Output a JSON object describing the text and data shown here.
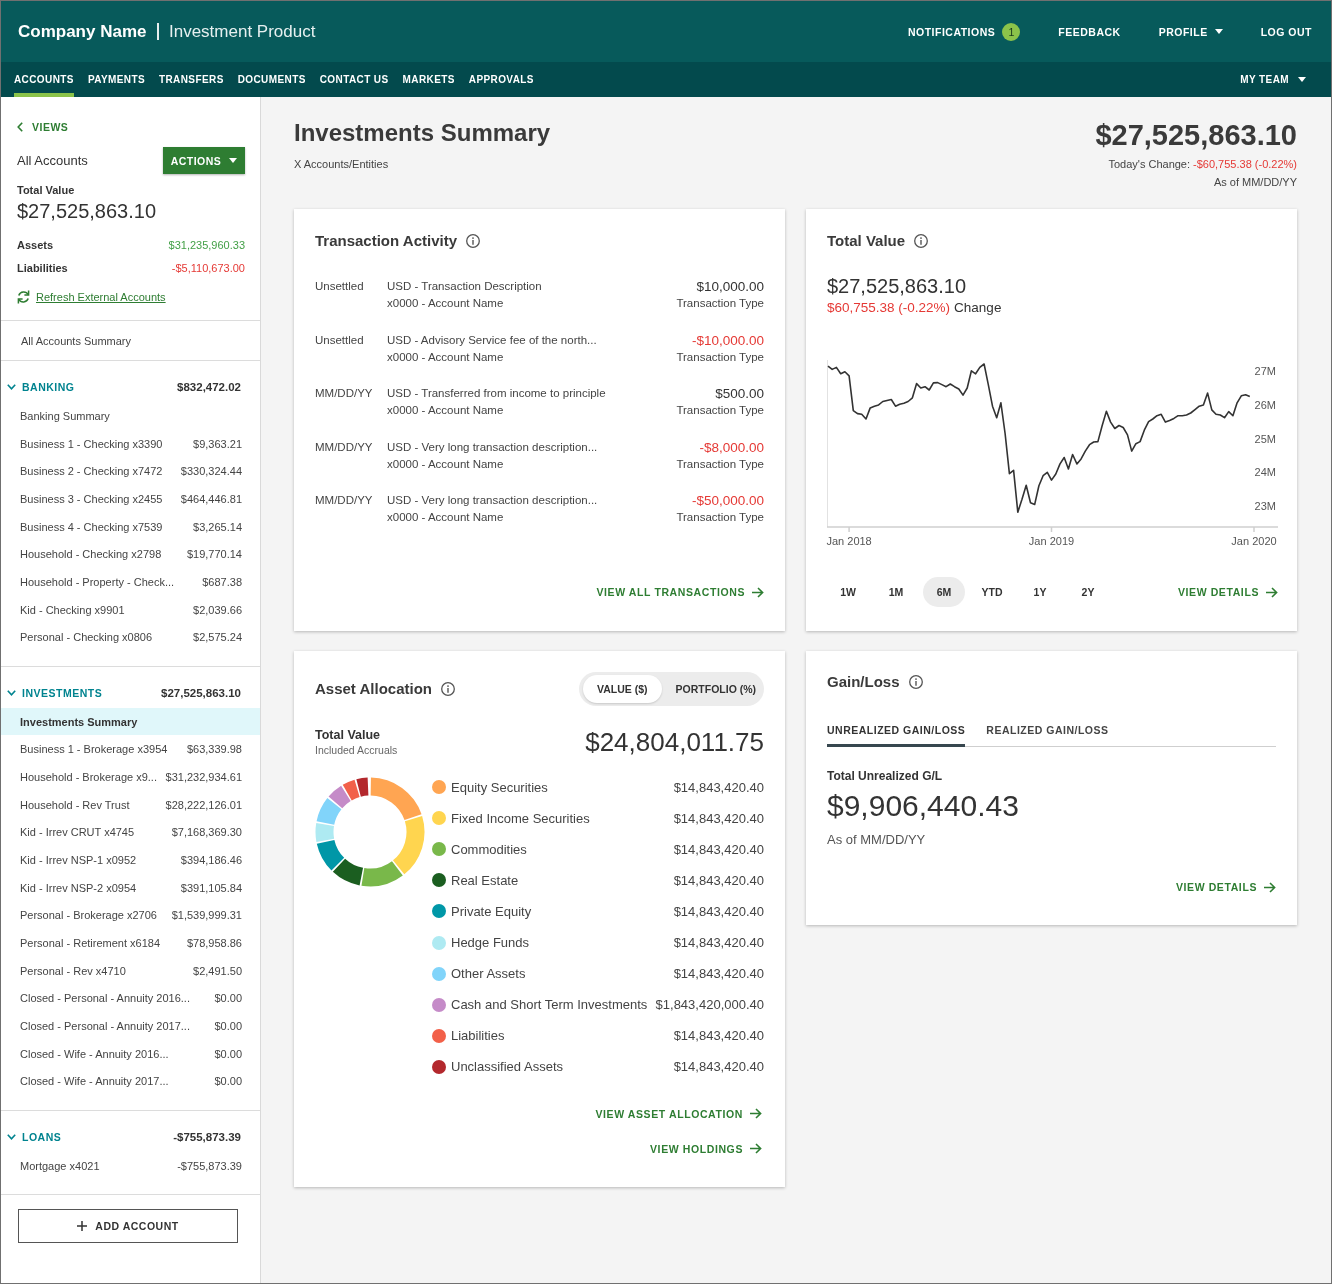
{
  "header": {
    "company": "Company Name",
    "product": "Investment Product",
    "links": [
      {
        "label": "NOTIFICATIONS",
        "badge": "1",
        "dropdown": false
      },
      {
        "label": "FEEDBACK",
        "dropdown": false
      },
      {
        "label": "PROFILE",
        "dropdown": true
      },
      {
        "label": "LOG OUT",
        "dropdown": false
      }
    ]
  },
  "nav": {
    "tabs": [
      {
        "label": "ACCOUNTS",
        "selected": true
      },
      {
        "label": "PAYMENTS",
        "selected": false
      },
      {
        "label": "TRANSFERS",
        "selected": false
      },
      {
        "label": "DOCUMENTS",
        "selected": false
      },
      {
        "label": "CONTACT US",
        "selected": false
      },
      {
        "label": "MARKETS",
        "selected": false
      },
      {
        "label": "APPROVALS",
        "selected": false
      }
    ],
    "team": {
      "label": "MY TEAM",
      "dropdown": true
    }
  },
  "sidebar": {
    "back_link": "VIEWS",
    "title": "All Accounts",
    "actions_button": "ACTIONS",
    "total_label": "Total Value",
    "total_value": "$27,525,863.10",
    "assets": {
      "label": "Assets",
      "value": "$31,235,960.33"
    },
    "liabilities": {
      "label": "Liabilities",
      "value": "-$5,110,673.00"
    },
    "refresh_link": "Refresh External Accounts",
    "summary_link": {
      "label": "All Accounts Summary",
      "selected": false
    },
    "sections": [
      {
        "title": "BANKING",
        "total": "$832,472.02",
        "expanded": true,
        "items": [
          {
            "name": "Banking Summary",
            "selected": false
          },
          {
            "name": "Business 1 - Checking x3390",
            "balance": "$9,363.21",
            "selected": false
          },
          {
            "name": "Business 2 - Checking x7472",
            "balance": "$330,324.44",
            "selected": false
          },
          {
            "name": "Business 3 - Checking x2455",
            "balance": "$464,446.81",
            "selected": false
          },
          {
            "name": "Business 4 - Checking x7539",
            "balance": "$3,265.14",
            "selected": false
          },
          {
            "name": "Household - Checking x2798",
            "balance": "$19,770.14",
            "selected": false
          },
          {
            "name": "Household - Property - Check...",
            "balance": "$687.38",
            "selected": false
          },
          {
            "name": "Kid - Checking x9901",
            "balance": "$2,039.66",
            "selected": false
          },
          {
            "name": "Personal - Checking x0806",
            "balance": "$2,575.24",
            "selected": false
          }
        ]
      },
      {
        "title": "INVESTMENTS",
        "total": "$27,525,863.10",
        "expanded": true,
        "items": [
          {
            "name": "Investments Summary",
            "selected": true
          },
          {
            "name": "Business 1 - Brokerage x3954",
            "balance": "$63,339.98",
            "selected": false
          },
          {
            "name": "Household - Brokerage x9...",
            "balance": "$31,232,934.61",
            "selected": false
          },
          {
            "name": "Household - Rev Trust",
            "balance": "$28,222,126.01",
            "selected": false
          },
          {
            "name": "Kid - Irrev CRUT x4745",
            "balance": "$7,168,369.30",
            "selected": false
          },
          {
            "name": "Kid - Irrev NSP-1 x0952",
            "balance": "$394,186.46",
            "selected": false
          },
          {
            "name": "Kid - Irrev NSP-2 x0954",
            "balance": "$391,105.84",
            "selected": false
          },
          {
            "name": "Personal - Brokerage x2706",
            "balance": "$1,539,999.31",
            "selected": false
          },
          {
            "name": "Personal - Retirement x6184",
            "balance": "$78,958.86",
            "selected": false
          },
          {
            "name": "Personal - Rev x4710",
            "balance": "$2,491.50",
            "selected": false
          },
          {
            "name": "Closed - Personal - Annuity 2016...",
            "balance": "$0.00",
            "selected": false
          },
          {
            "name": "Closed - Personal - Annuity 2017...",
            "balance": "$0.00",
            "selected": false
          },
          {
            "name": "Closed - Wife - Annuity 2016...",
            "balance": "$0.00",
            "selected": false
          },
          {
            "name": "Closed - Wife - Annuity 2017...",
            "balance": "$0.00",
            "selected": false
          }
        ]
      },
      {
        "title": "LOANS",
        "total": "-$755,873.39",
        "expanded": true,
        "items": [
          {
            "name": "Mortgage x4021",
            "balance": "-$755,873.39",
            "selected": false
          }
        ]
      }
    ],
    "add_button": "ADD ACCOUNT"
  },
  "summary": {
    "title": "Investments Summary",
    "subtitle": "X Accounts/Entities",
    "total": "$27,525,863.10",
    "change_label": "Today's Change:",
    "change_value": "-$60,755.38 (-0.22%)",
    "as_of": "As of MM/DD/YY"
  },
  "transactions": {
    "title": "Transaction Activity",
    "rows": [
      {
        "status": "Unsettled",
        "description": "USD - Transaction Description",
        "account": "x0000 - Account Name",
        "amount": "$10,000.00",
        "negative": false,
        "type": "Transaction Type"
      },
      {
        "status": "Unsettled",
        "description": "USD - Advisory Service fee of the north...",
        "account": "x0000 - Account Name",
        "amount": "-$10,000.00",
        "negative": true,
        "type": "Transaction Type"
      },
      {
        "status": "MM/DD/YY",
        "description": "USD - Transferred from income to principle",
        "account": "x0000 - Account Name",
        "amount": "$500.00",
        "negative": false,
        "type": "Transaction Type"
      },
      {
        "status": "MM/DD/YY",
        "description": "USD - Very long transaction description...",
        "account": "x0000 - Account Name",
        "amount": "-$8,000.00",
        "negative": true,
        "type": "Transaction Type"
      },
      {
        "status": "MM/DD/YY",
        "description": "USD - Very long transaction description...",
        "account": "x0000 - Account Name",
        "amount": "-$50,000.00",
        "negative": true,
        "type": "Transaction Type"
      }
    ],
    "link": "VIEW ALL TRANSACTIONS"
  },
  "total_value": {
    "title": "Total Value",
    "value": "$27,525,863.10",
    "change": "$60,755.38 (-0.22%)",
    "change_label": "Change",
    "chart_data": {
      "type": "line",
      "categories": [
        null,
        null,
        null,
        null,
        null,
        "Jan 2018",
        null,
        null,
        null,
        null,
        null,
        null,
        null,
        null,
        null,
        null,
        null,
        null,
        null,
        null,
        null,
        null,
        null,
        null,
        null,
        null,
        null,
        null,
        null,
        null,
        null,
        null,
        null,
        null,
        null,
        null,
        null,
        null,
        null,
        null,
        null,
        null,
        null,
        null,
        null,
        null,
        null,
        null,
        null,
        null,
        null,
        null,
        null,
        "Jan 2019",
        null,
        null,
        null,
        null,
        null,
        null,
        null,
        null,
        null,
        null,
        null,
        null,
        null,
        null,
        null,
        null,
        null,
        null,
        null,
        null,
        null,
        null,
        null,
        null,
        null,
        null,
        null,
        null,
        null,
        null,
        null,
        null,
        null,
        null,
        null,
        null,
        null,
        null,
        null,
        null,
        null,
        null,
        null,
        null,
        null,
        null,
        null,
        "Jan 2020"
      ],
      "values": [
        27.15,
        27.05,
        27.11,
        26.92,
        26.98,
        26.86,
        25.83,
        25.74,
        25.72,
        25.58,
        25.91,
        25.96,
        26.0,
        26.1,
        26.13,
        26.16,
        25.96,
        26.02,
        26.05,
        26.1,
        26.21,
        26.63,
        26.5,
        26.54,
        26.44,
        26.65,
        26.66,
        26.6,
        26.54,
        26.62,
        26.54,
        26.47,
        26.29,
        26.5,
        27.01,
        26.92,
        27.11,
        27.21,
        26.6,
        25.96,
        25.62,
        26.06,
        25.15,
        23.96,
        24.06,
        22.82,
        23.2,
        23.62,
        23.1,
        23.05,
        23.6,
        23.9,
        24.0,
        23.77,
        23.95,
        24.25,
        24.44,
        24.1,
        24.53,
        24.25,
        24.4,
        24.63,
        24.82,
        24.9,
        24.91,
        25.39,
        25.81,
        25.49,
        25.3,
        25.39,
        25.33,
        25.11,
        24.63,
        24.85,
        24.91,
        25.25,
        25.5,
        25.58,
        25.68,
        25.72,
        25.49,
        25.54,
        25.6,
        25.68,
        25.68,
        25.7,
        25.76,
        25.86,
        25.96,
        26.0,
        26.35,
        25.85,
        25.72,
        25.7,
        25.62,
        25.8,
        25.68,
        26.06,
        26.27,
        26.3,
        26.25,
        null
      ],
      "ylim": [
        22.38,
        27.33
      ],
      "yticks": [
        {
          "value": 23,
          "label": "23M"
        },
        {
          "value": 24,
          "label": "24M"
        },
        {
          "value": 25,
          "label": "25M"
        },
        {
          "value": 26,
          "label": "26M"
        },
        {
          "value": 27,
          "label": "27M"
        }
      ]
    },
    "ranges": [
      {
        "label": "1W",
        "selected": false
      },
      {
        "label": "1M",
        "selected": false
      },
      {
        "label": "6M",
        "selected": true
      },
      {
        "label": "YTD",
        "selected": false
      },
      {
        "label": "1Y",
        "selected": false
      },
      {
        "label": "2Y",
        "selected": false
      }
    ],
    "link": "VIEW DETAILS"
  },
  "asset_allocation": {
    "title": "Asset Allocation",
    "toggle": [
      {
        "label": "VALUE ($)",
        "selected": true
      },
      {
        "label": "PORTFOLIO (%)",
        "selected": false
      }
    ],
    "total_label": "Total Value",
    "total_note": "Included Accruals",
    "total": "$24,804,011.75",
    "categories": [
      {
        "name": "Equity Securities",
        "value": "$14,843,420.40",
        "color": "#ffa552"
      },
      {
        "name": "Fixed Income Securities",
        "value": "$14,843,420.40",
        "color": "#ffd54f"
      },
      {
        "name": "Commodities",
        "value": "$14,843,420.40",
        "color": "#79b84a"
      },
      {
        "name": "Real Estate",
        "value": "$14,843,420.40",
        "color": "#1b5e20"
      },
      {
        "name": "Private Equity",
        "value": "$14,843,420.40",
        "color": "#0097a7"
      },
      {
        "name": "Hedge Funds",
        "value": "$14,843,420.40",
        "color": "#aeeaf2"
      },
      {
        "name": "Other Assets",
        "value": "$14,843,420.40",
        "color": "#81d4fa"
      },
      {
        "name": "Cash and Short Term Investments",
        "value": "$1,843,420,000.40",
        "color": "#c58bc8"
      },
      {
        "name": "Liabilities",
        "value": "$14,843,420.40",
        "color": "#f26049"
      },
      {
        "name": "Unclassified Assets",
        "value": "$14,843,420.40",
        "color": "#b3282d"
      }
    ],
    "links": [
      "VIEW ASSET ALLOCATION",
      "VIEW HOLDINGS"
    ]
  },
  "gain_loss": {
    "title": "Gain/Loss",
    "tabs": [
      {
        "label": "UNREALIZED GAIN/LOSS",
        "selected": true
      },
      {
        "label": "REALIZED GAIN/LOSS",
        "selected": false
      }
    ],
    "total_label": "Total Unrealized G/L",
    "total": "$9,906,440.43",
    "as_of": "As of MM/DD/YY",
    "link": "VIEW DETAILS"
  }
}
